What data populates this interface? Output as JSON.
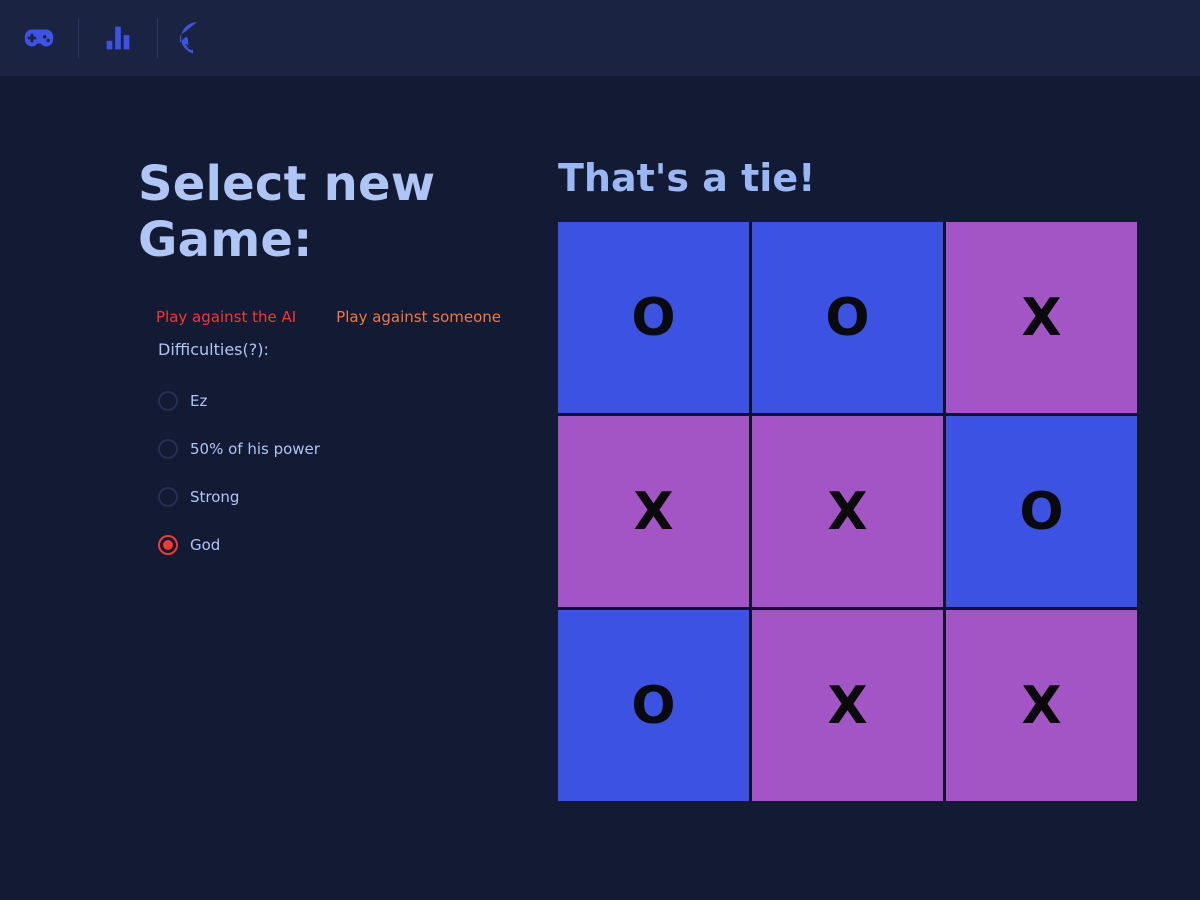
{
  "header": {
    "icons": [
      "gamepad",
      "leaderboard",
      "github"
    ]
  },
  "left": {
    "title": "Select new Game:",
    "mode_ai": "Play against the AI",
    "mode_human": "Play against someone",
    "difficulties_label": "Difficulties(?):",
    "difficulties": [
      {
        "label": "Ez",
        "selected": false
      },
      {
        "label": "50% of his power",
        "selected": false
      },
      {
        "label": "Strong",
        "selected": false
      },
      {
        "label": "God",
        "selected": true
      }
    ]
  },
  "game": {
    "status": "That's a tie!",
    "board": [
      [
        "O",
        "O",
        "X"
      ],
      [
        "X",
        "X",
        "O"
      ],
      [
        "O",
        "X",
        "X"
      ]
    ]
  },
  "colors": {
    "cell_O": "#3b52e3",
    "cell_X": "#a355c5",
    "accent_red": "#f53731",
    "accent_orange": "#f4763f"
  }
}
